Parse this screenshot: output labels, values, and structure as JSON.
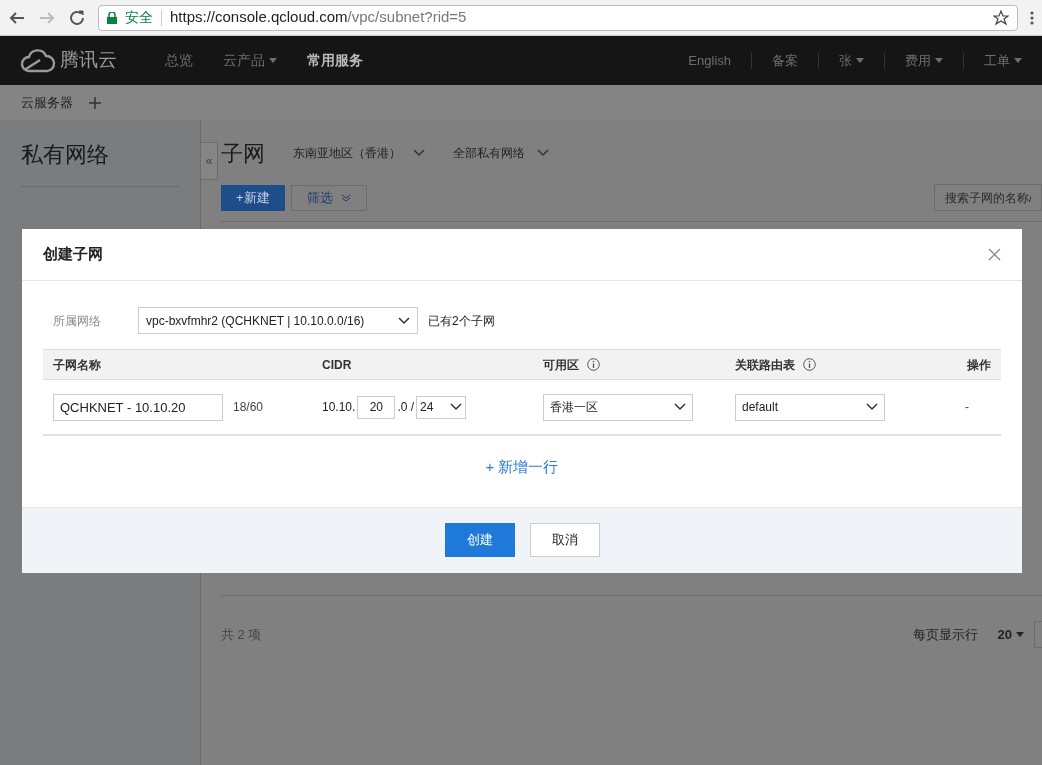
{
  "browser": {
    "secure_label": "安全",
    "url_host": "https://console.qcloud.com",
    "url_path": "/vpc/subnet?rid=5"
  },
  "topnav": {
    "brand": "腾讯云",
    "items": [
      {
        "label": "总览",
        "selected": false,
        "caret": false
      },
      {
        "label": "云产品",
        "selected": false,
        "caret": true
      },
      {
        "label": "常用服务",
        "selected": true,
        "caret": false
      }
    ],
    "right_items": [
      {
        "label": "English",
        "caret": false
      },
      {
        "label": "备案",
        "caret": false
      },
      {
        "label": "张",
        "caret": true
      },
      {
        "label": "费用",
        "caret": true
      },
      {
        "label": "工单",
        "caret": true
      }
    ]
  },
  "tabs": [
    {
      "label": "云服务器"
    }
  ],
  "sidebar": {
    "title": "私有网络",
    "collapse": "«"
  },
  "page": {
    "title": "子网",
    "filters": [
      "东南亚地区（香港）",
      "全部私有网络"
    ],
    "new_button": "+新建",
    "filter_button": "筛选",
    "search_placeholder": "搜索子网的名称/",
    "total": "共 2 项",
    "page_size_label": "每页显示行",
    "page_size": "20"
  },
  "modal": {
    "title": "创建子网",
    "network_label": "所属网络",
    "network": "vpc-bxvfmhr2 (QCHKNET | 10.10.0.0/16)",
    "subnet_count": "已有2个子网",
    "columns": [
      {
        "label": "子网名称",
        "info": false
      },
      {
        "label": "CIDR",
        "info": false
      },
      {
        "label": "可用区",
        "info": true
      },
      {
        "label": "关联路由表",
        "info": true
      },
      {
        "label": "操作",
        "info": false
      }
    ],
    "rows": [
      {
        "name": "QCHKNET - 10.10.20",
        "count": "18/60",
        "cidr_prefix": "10.10.",
        "cidr_third": "20",
        "cidr_sep": ".0 /",
        "mask": "24",
        "zone": "香港一区",
        "route_table": "default",
        "action": "-"
      }
    ],
    "add_row": "+ 新增一行",
    "buttons": [
      {
        "label": "创建",
        "kind": "primary"
      },
      {
        "label": "取消",
        "kind": "secondary"
      }
    ]
  }
}
